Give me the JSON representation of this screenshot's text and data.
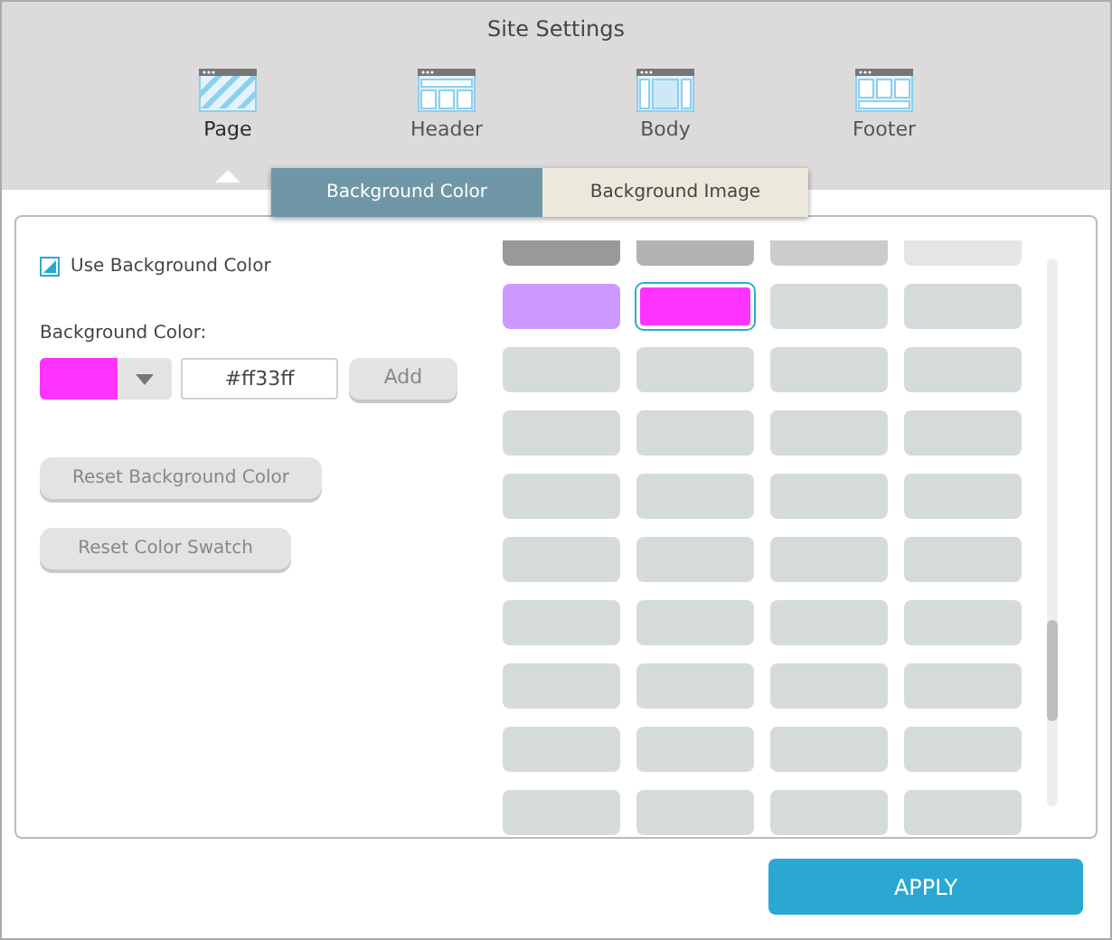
{
  "window": {
    "title": "Site Settings"
  },
  "sections": [
    {
      "label": "Page",
      "kind": "page",
      "selected": true
    },
    {
      "label": "Header",
      "kind": "header",
      "selected": false
    },
    {
      "label": "Body",
      "kind": "body",
      "selected": false
    },
    {
      "label": "Footer",
      "kind": "footer",
      "selected": false
    }
  ],
  "tabs": [
    {
      "label": "Background Color",
      "selected": true
    },
    {
      "label": "Background Image",
      "selected": false
    }
  ],
  "use_background_color": {
    "label": "Use Background Color",
    "checked": true
  },
  "background_color": {
    "label": "Background Color:",
    "color": "#ff33ff",
    "value": "#ff33ff",
    "add_button": "Add"
  },
  "buttons": [
    "Reset Background Color",
    "Reset Color Swatch"
  ],
  "swatch_rows": [
    [
      {
        "color": "#999999",
        "selected": false
      },
      {
        "color": "#b2b2b2",
        "selected": false
      },
      {
        "color": "#cccccc",
        "selected": false
      },
      {
        "color": "#e5e5e5",
        "selected": false
      }
    ],
    [
      {
        "color": "#cc99ff",
        "selected": false
      },
      {
        "color": "#ff33ff",
        "selected": true
      },
      {
        "color": "#d5dbdb",
        "selected": false
      },
      {
        "color": "#d5dbdb",
        "selected": false
      }
    ],
    [
      {
        "color": "#d5dbdb",
        "selected": false
      },
      {
        "color": "#d5dbdb",
        "selected": false
      },
      {
        "color": "#d5dbdb",
        "selected": false
      },
      {
        "color": "#d5dbdb",
        "selected": false
      }
    ],
    [
      {
        "color": "#d5dbdb",
        "selected": false
      },
      {
        "color": "#d5dbdb",
        "selected": false
      },
      {
        "color": "#d5dbdb",
        "selected": false
      },
      {
        "color": "#d5dbdb",
        "selected": false
      }
    ],
    [
      {
        "color": "#d5dbdb",
        "selected": false
      },
      {
        "color": "#d5dbdb",
        "selected": false
      },
      {
        "color": "#d5dbdb",
        "selected": false
      },
      {
        "color": "#d5dbdb",
        "selected": false
      }
    ],
    [
      {
        "color": "#d5dbdb",
        "selected": false
      },
      {
        "color": "#d5dbdb",
        "selected": false
      },
      {
        "color": "#d5dbdb",
        "selected": false
      },
      {
        "color": "#d5dbdb",
        "selected": false
      }
    ],
    [
      {
        "color": "#d5dbdb",
        "selected": false
      },
      {
        "color": "#d5dbdb",
        "selected": false
      },
      {
        "color": "#d5dbdb",
        "selected": false
      },
      {
        "color": "#d5dbdb",
        "selected": false
      }
    ],
    [
      {
        "color": "#d5dbdb",
        "selected": false
      },
      {
        "color": "#d5dbdb",
        "selected": false
      },
      {
        "color": "#d5dbdb",
        "selected": false
      },
      {
        "color": "#d5dbdb",
        "selected": false
      }
    ],
    [
      {
        "color": "#d5dbdb",
        "selected": false
      },
      {
        "color": "#d5dbdb",
        "selected": false
      },
      {
        "color": "#d5dbdb",
        "selected": false
      },
      {
        "color": "#d5dbdb",
        "selected": false
      }
    ],
    [
      {
        "color": "#d5dbdb",
        "selected": false
      },
      {
        "color": "#d5dbdb",
        "selected": false
      },
      {
        "color": "#d5dbdb",
        "selected": false
      },
      {
        "color": "#d5dbdb",
        "selected": false
      }
    ]
  ],
  "apply_button": "APPLY"
}
